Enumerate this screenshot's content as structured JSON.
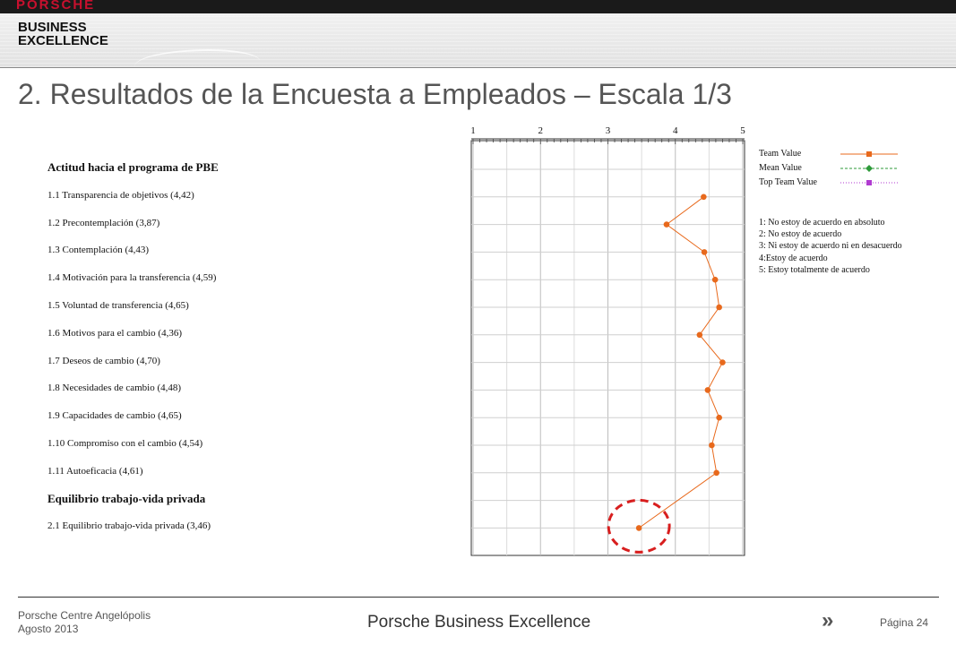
{
  "header": {
    "brand": "PORSCHE",
    "sub_brand_line1": "BUSINESS",
    "sub_brand_line2": "EXCELLENCE"
  },
  "title": "2. Resultados de la Encuesta a Empleados – Escala 1/3",
  "footer": {
    "left_line1": "Porsche Centre  Angelópolis",
    "left_line2": "Agosto 2013",
    "center": "Porsche Business Excellence",
    "arrows": "»",
    "page": "Página 24"
  },
  "chart_data": {
    "type": "line",
    "orientation": "horizontal",
    "x_ticks": [
      "1",
      "2",
      "3",
      "4",
      "5"
    ],
    "xlim": [
      1,
      5
    ],
    "grid": true,
    "rows": [
      {
        "label": "Actitud hacia el programa de PBE",
        "heading": true
      },
      {
        "label": "1.1 Transparencia de objetivos (4,42)",
        "value": 4.42
      },
      {
        "label": "1.2 Precontemplación (3,87)",
        "value": 3.87
      },
      {
        "label": "1.3 Contemplación (4,43)",
        "value": 4.43
      },
      {
        "label": "1.4 Motivación para la transferencia (4,59)",
        "value": 4.59
      },
      {
        "label": "1.5 Voluntad de transferencia (4,65)",
        "value": 4.65
      },
      {
        "label": "1.6 Motivos para el cambio (4,36)",
        "value": 4.36
      },
      {
        "label": "1.7 Deseos de cambio (4,70)",
        "value": 4.7
      },
      {
        "label": "1.8 Necesidades de cambio (4,48)",
        "value": 4.48
      },
      {
        "label": "1.9 Capacidades de cambio (4,65)",
        "value": 4.65
      },
      {
        "label": "1.10 Compromiso con el cambio (4,54)",
        "value": 4.54
      },
      {
        "label": "1.11 Autoeficacia (4,61)",
        "value": 4.61
      },
      {
        "label": "Equilibrio trabajo-vida privada",
        "heading": true
      },
      {
        "label": "2.1 Equilibrio trabajo-vida privada (3,46)",
        "value": 3.46,
        "highlighted": true
      }
    ],
    "legend": [
      {
        "label": "Team Value",
        "color": "#e8691c",
        "style": "solid",
        "marker": "square"
      },
      {
        "label": "Mean Value",
        "color": "#2e9a3a",
        "style": "dashed",
        "marker": "diamond"
      },
      {
        "label": "Top Team Value",
        "color": "#b03ad0",
        "style": "dotted",
        "marker": "square"
      }
    ],
    "scale_notes": [
      "1: No estoy de acuerdo en absoluto",
      "2: No estoy de acuerdo",
      "3: Ni estoy de acuerdo ni en desacuerdo",
      "4:Estoy de acuerdo",
      "5: Estoy totalmente de acuerdo"
    ],
    "colors": {
      "series": "#e8691c",
      "highlight_circle": "#d81e1e"
    }
  }
}
